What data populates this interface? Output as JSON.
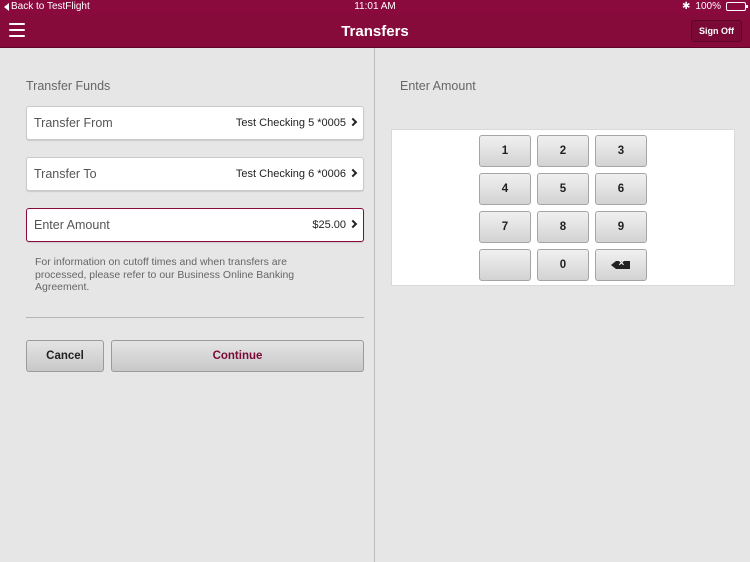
{
  "status_bar": {
    "back_label": "Back to TestFlight",
    "time": "11:01 AM",
    "bluetooth": "✱",
    "battery": "100%",
    "battery_level": 1.0
  },
  "nav": {
    "title": "Transfers",
    "signoff_label": "Sign Off"
  },
  "transfer": {
    "section_title": "Transfer Funds",
    "from": {
      "label": "Transfer From",
      "value": "Test Checking 5 *0005"
    },
    "to": {
      "label": "Transfer To",
      "value": "Test Checking 6 *0006"
    },
    "amount": {
      "label": "Enter Amount",
      "value": "$25.00"
    },
    "info_text": "For information on cutoff times and when transfers are processed, please refer to our Business Online Banking Agreement.",
    "cancel_label": "Cancel",
    "continue_label": "Continue"
  },
  "keypad": {
    "title": "Enter Amount",
    "keys": [
      "1",
      "2",
      "3",
      "4",
      "5",
      "6",
      "7",
      "8",
      "9",
      "",
      "0"
    ],
    "backspace_icon": "backspace-icon"
  },
  "colors": {
    "brand": "#8b0a3e",
    "continue_text": "#7a0935"
  }
}
